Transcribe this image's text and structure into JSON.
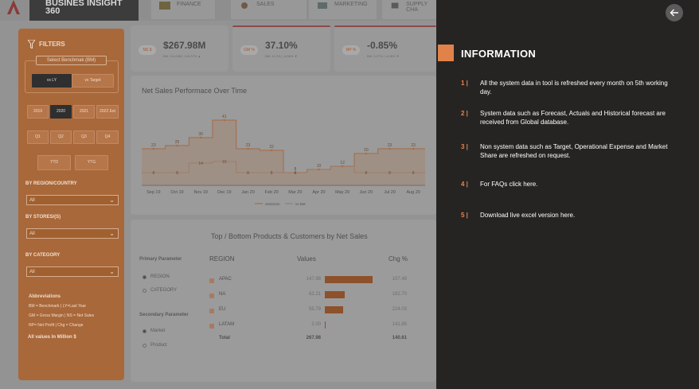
{
  "app": {
    "title": "BUSINES INSIGHT 360"
  },
  "nav": {
    "tabs": [
      {
        "label": "FINANCE"
      },
      {
        "label": "SALES"
      },
      {
        "label": "MARKETING"
      },
      {
        "label": "SUPPLY CHA"
      }
    ]
  },
  "filters": {
    "title": "FILTERS",
    "benchmark_label": "Select Benchmak (BM)",
    "benchmark_options": [
      "vs LY",
      "vs Target"
    ],
    "years": [
      "2019",
      "2020",
      "2021",
      "2022 Est"
    ],
    "quarters": [
      "Q1",
      "Q2",
      "Q3",
      "Q4"
    ],
    "periods": [
      "YTD",
      "YTG"
    ],
    "region_label": "BY REGION/COUNTRY",
    "region_value": "All",
    "stores_label": "BY STORES/(S)",
    "stores_value": "All",
    "category_label": "BY CATEGORY",
    "category_value": "All",
    "abbr_title": "Abbreviations",
    "abbr_lines": [
      "BM = Benchmark | LY=Last Year",
      "GM = Gross Margin | NS = Net Sales",
      "NP= Net Profit | Chg = Change"
    ],
    "all_values": "All values In Million $"
  },
  "kpis": [
    {
      "tag": "NS $",
      "value": "$267.98M",
      "sub": "BM: 111.63M | 140.07% ▲"
    },
    {
      "tag": "GM %",
      "value": "37.10%",
      "sub": "BM: 41.2% | -8.56% ▼"
    },
    {
      "tag": "NP %",
      "value": "-0.85%",
      "sub": "BM: 3.27% | -4.06% ▼"
    }
  ],
  "chart_title": "Net Sales Performace Over Time",
  "chart_data": {
    "type": "line",
    "categories": [
      "Sep 19",
      "Oct 19",
      "Nov 19",
      "Dec 19",
      "Jan 20",
      "Feb 20",
      "Mar 20",
      "Apr 20",
      "May 20",
      "Jun 20",
      "Jul 20",
      "Aug 20"
    ],
    "series": [
      {
        "name": "Selection",
        "values": [
          23,
          25,
          30,
          41,
          23,
          22,
          8,
          10,
          12,
          20,
          23,
          23
        ]
      },
      {
        "name": "vs BM",
        "values": [
          8,
          8,
          14,
          15,
          8,
          8,
          8,
          10,
          12,
          8,
          8,
          8
        ]
      }
    ],
    "data_labels_top": [
      "23",
      "25",
      "30",
      "41",
      "23",
      "22",
      "8",
      "10",
      "12",
      "20",
      "23",
      "23"
    ],
    "data_labels_bottom": [
      "8",
      "8",
      "14",
      "15",
      "8",
      "8",
      "8",
      "",
      "",
      "8",
      "8",
      "8"
    ],
    "legend": [
      "Selection",
      "vs BM"
    ],
    "colors": {
      "selection": "#a66a43",
      "bm": "#a67b62"
    }
  },
  "table": {
    "title": "Top / Bottom Products & Customers by Net Sales",
    "headers": {
      "region": "REGION",
      "values": "Values",
      "chg": "Chg %"
    },
    "rows": [
      {
        "name": "APAC",
        "value": "147.98",
        "value_num": 147.98,
        "chg": "107.48"
      },
      {
        "name": "NA",
        "value": "62.21",
        "value_num": 62.21,
        "chg": "182.70"
      },
      {
        "name": "EU",
        "value": "55.79",
        "value_num": 55.79,
        "chg": "224.03"
      },
      {
        "name": "LATAM",
        "value": "2.00",
        "value_num": 2.0,
        "chg": "141.85"
      }
    ],
    "total": {
      "name": "Total",
      "value": "267.98",
      "chg": "140.61"
    },
    "primary_param": "Primary Parameter",
    "primary_options": [
      "REGION",
      "CATEGORY"
    ],
    "secondary_param": "Secondary Parameter",
    "secondary_options": [
      "Market",
      "Product"
    ]
  },
  "info": {
    "title": "INFORMATION",
    "back_icon": "arrow-left-icon",
    "items": [
      {
        "no": "1 |",
        "text": "All the system data in tool is refreshed every month on 5th working day."
      },
      {
        "no": "2 |",
        "text": "System data such as Forecast, Actuals and Historical forecast are received from Global database."
      },
      {
        "no": "3 |",
        "text": "Non system data such as Target, Operational Expense and Market Share are refreshed on request."
      },
      {
        "no": "4 |",
        "text": "For FAQs click here."
      },
      {
        "no": "5 |",
        "text": "Download live excel version here."
      }
    ]
  }
}
